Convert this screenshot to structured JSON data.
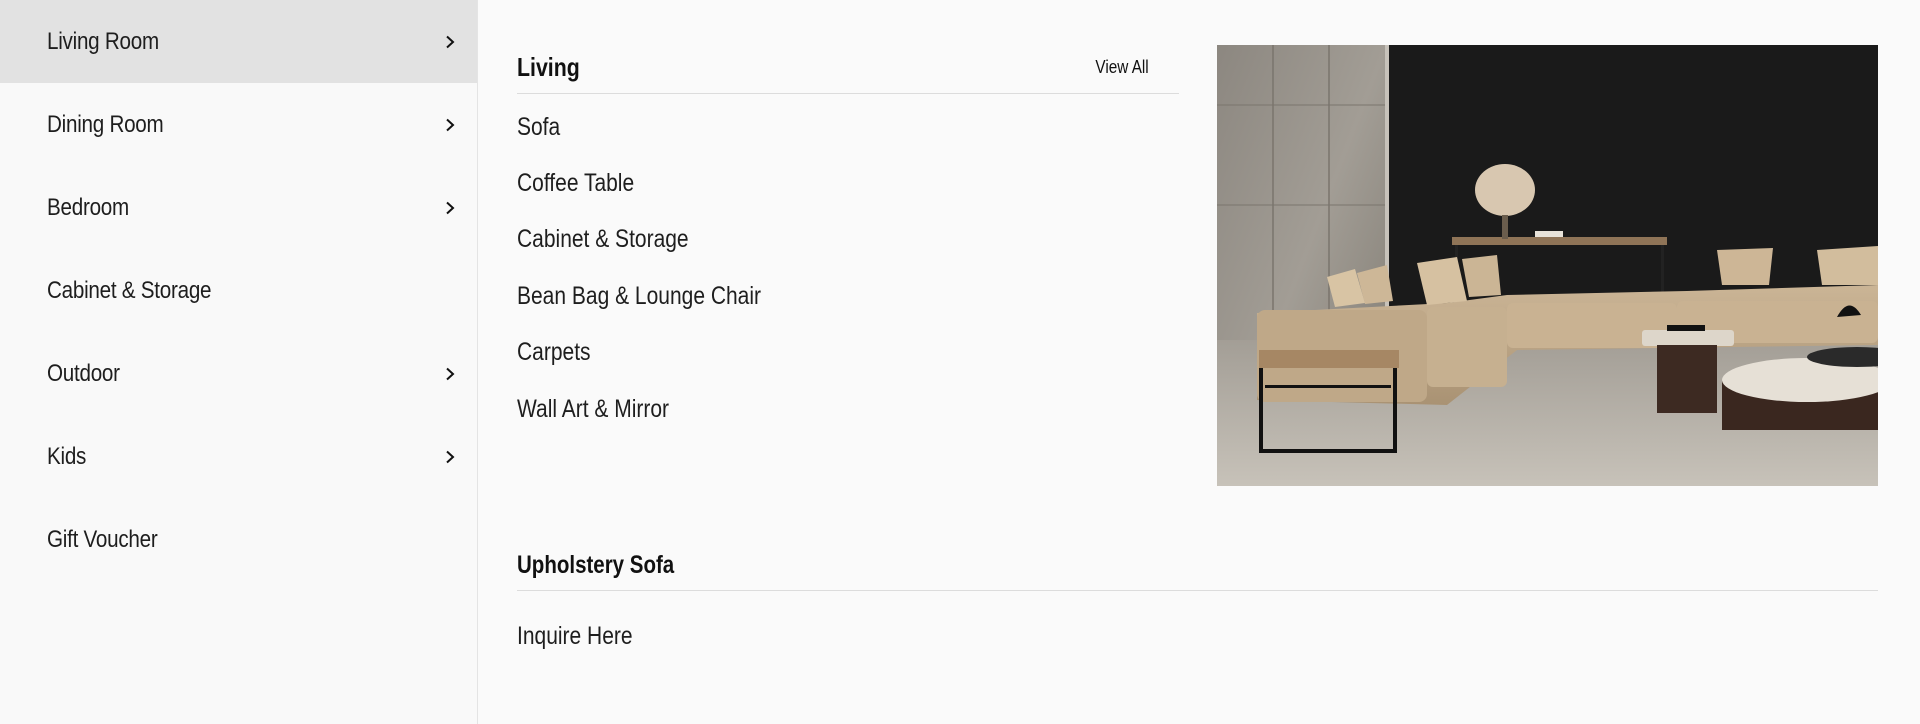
{
  "sidebar": {
    "items": [
      {
        "label": "Living Room",
        "has_chevron": true,
        "active": true
      },
      {
        "label": "Dining Room",
        "has_chevron": true,
        "active": false
      },
      {
        "label": "Bedroom",
        "has_chevron": true,
        "active": false
      },
      {
        "label": "Cabinet & Storage",
        "has_chevron": false,
        "active": false
      },
      {
        "label": "Outdoor",
        "has_chevron": true,
        "active": false
      },
      {
        "label": "Kids",
        "has_chevron": true,
        "active": false
      },
      {
        "label": "Gift Voucher",
        "has_chevron": false,
        "active": false
      }
    ],
    "chevron_icon": "chevron-right-icon",
    "active_bg": "#e2e2e2"
  },
  "living": {
    "title": "Living",
    "view_all": "View All",
    "links": [
      "Sofa",
      "Coffee Table",
      "Cabinet & Storage",
      "Bean Bag & Lounge Chair",
      "Carpets",
      "Wall Art & Mirror"
    ]
  },
  "promo_image": {
    "subject": "living-room-sofa-photo"
  },
  "upholstery": {
    "title": "Upholstery Sofa",
    "link": "Inquire Here"
  }
}
